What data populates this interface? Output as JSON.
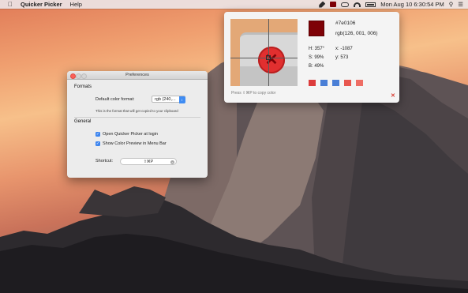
{
  "menubar": {
    "app_name": "Quicker Picker",
    "help": "Help",
    "clock": "Mon Aug 10  6:30:54 PM",
    "icons": [
      "apple-icon",
      "eyedropper-icon",
      "color-swatch-icon",
      "cloud-icon",
      "wifi-icon",
      "battery-icon",
      "search-icon",
      "list-icon"
    ]
  },
  "preferences": {
    "title": "Preferences",
    "formats_heading": "Formats",
    "default_format_label": "Default color format:",
    "default_format_value": "rgb (240,...",
    "format_hint": "This is the format that will get copied to your clipboard",
    "general_heading": "General",
    "open_at_login": {
      "label": "Open Quicker Picker at login",
      "checked": true
    },
    "show_preview": {
      "label": "Show Color Preview in Menu Bar",
      "checked": true
    },
    "shortcut_label": "Shortcut:",
    "shortcut_value": "⇧⌘P"
  },
  "picker": {
    "hex": "#7e0106",
    "rgb": "rgb(126, 001, 006)",
    "h": "H:  357°",
    "s": "S:  99%",
    "b": "B:  49%",
    "x": "x:  -1087",
    "y": "y:  573",
    "copy_hint": "Press ⇧⌘P to copy color",
    "current_color": "#7e0106",
    "recent_colors": [
      "#dc3c3c",
      "#4a7fd6",
      "#4a7fd6",
      "#e8574f",
      "#ee6d64"
    ]
  }
}
